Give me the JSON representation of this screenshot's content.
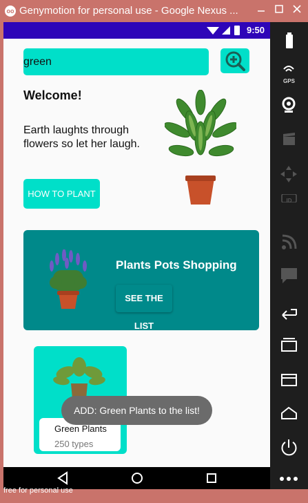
{
  "window": {
    "title": "Genymotion for personal use - Google Nexus ...",
    "logo": "oo"
  },
  "statusbar": {
    "time": "9:50"
  },
  "search": {
    "value": "green"
  },
  "welcome": {
    "title": "Welcome!",
    "tagline": "Earth laughts through flowers so let her laugh.",
    "button": "HOW TO PLANT"
  },
  "banner": {
    "title": "Plants Pots Shopping",
    "button": "SEE THE LIST"
  },
  "card": {
    "name": "Green Plants",
    "types": "250 types"
  },
  "toast": {
    "text": "ADD: Green Plants to the list!"
  },
  "footer": {
    "text": "free for personal use"
  },
  "sidebar": {
    "gps_label": "GPS",
    "id_label": "ID"
  },
  "colors": {
    "accent": "#00dfc9",
    "banner": "#00898a",
    "statusbar": "#2e05b8",
    "frame": "#c9736b"
  }
}
